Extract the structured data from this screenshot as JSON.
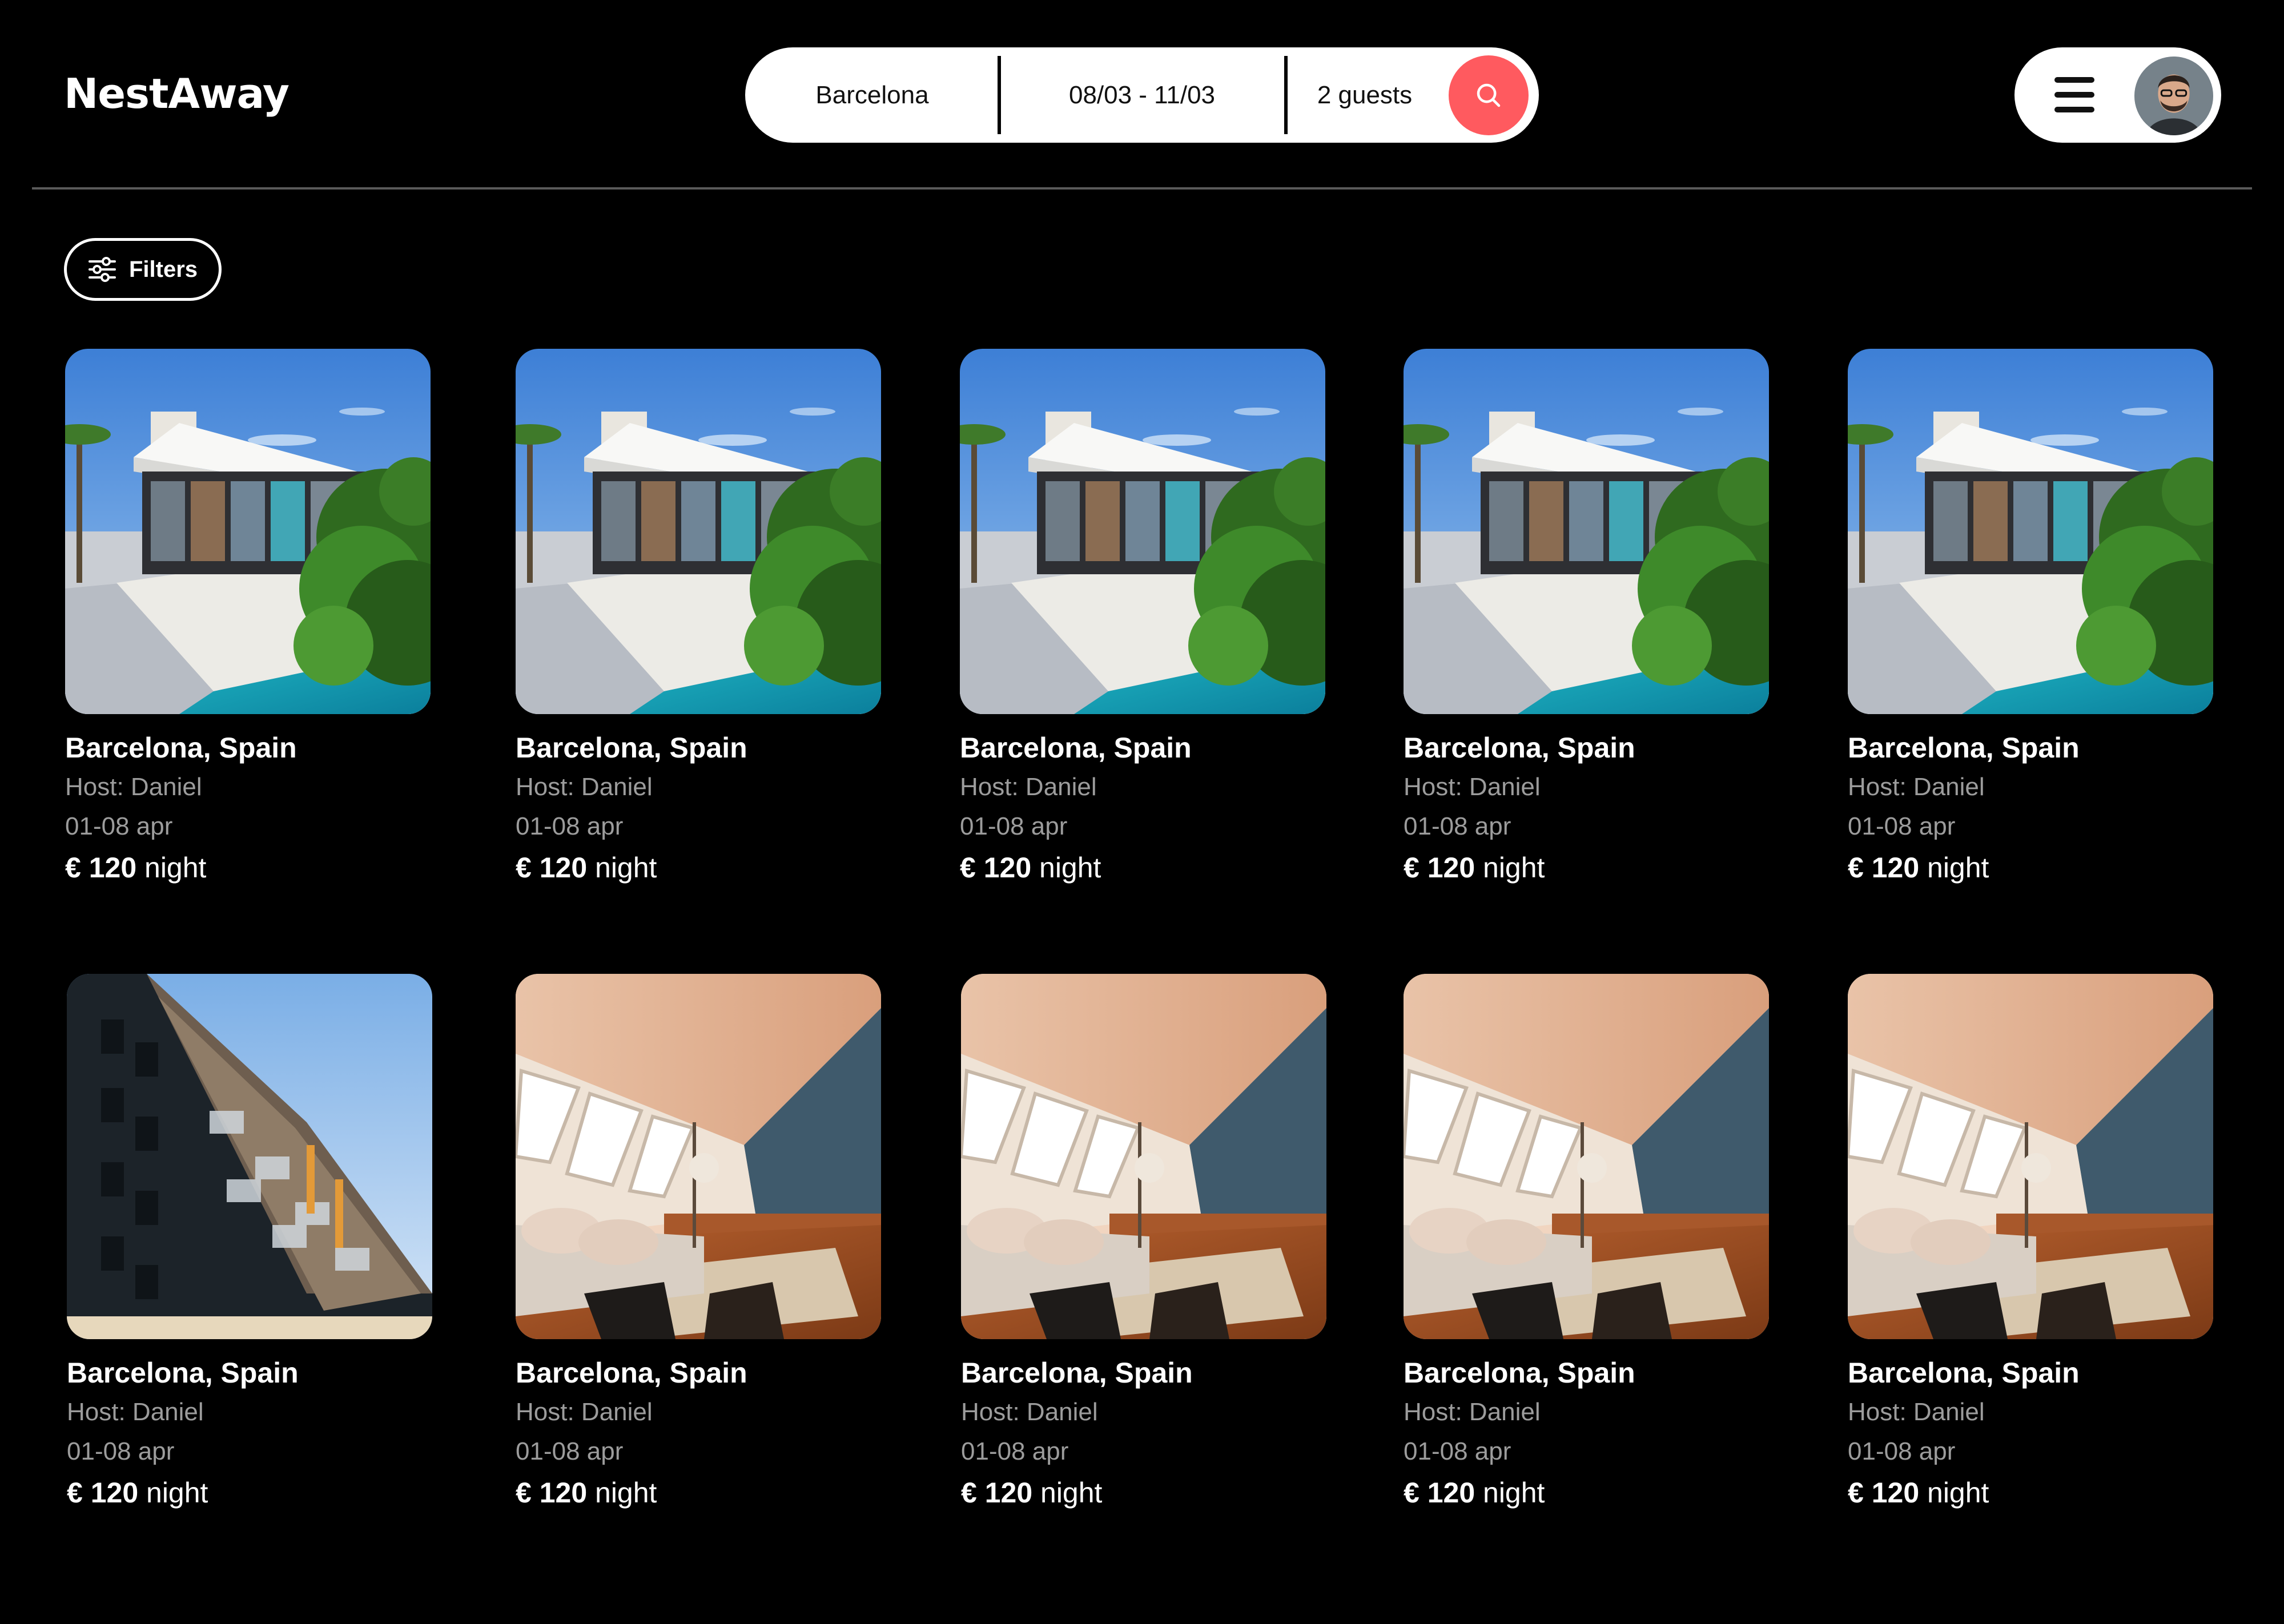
{
  "app": {
    "logo": "NestAway"
  },
  "search": {
    "location": "Barcelona",
    "dates": "08/03 - 11/03",
    "guests": "2 guests",
    "search_icon": "search-icon",
    "accent": "#ff5a5f"
  },
  "account": {
    "menu_icon": "hamburger-menu-icon",
    "avatar": "user-avatar"
  },
  "filters": {
    "label": "Filters",
    "icon": "sliders-icon"
  },
  "listings": [
    {
      "title": "Barcelona, Spain",
      "host": "Host: Daniel",
      "dates": "01-08 apr",
      "price": "€ 120",
      "unit": " night",
      "photo": "villa-pool"
    },
    {
      "title": "Barcelona, Spain",
      "host": "Host: Daniel",
      "dates": "01-08 apr",
      "price": "€ 120",
      "unit": " night",
      "photo": "villa-pool"
    },
    {
      "title": "Barcelona, Spain",
      "host": "Host: Daniel",
      "dates": "01-08 apr",
      "price": "€ 120",
      "unit": " night",
      "photo": "villa-pool"
    },
    {
      "title": "Barcelona, Spain",
      "host": "Host: Daniel",
      "dates": "01-08 apr",
      "price": "€ 120",
      "unit": " night",
      "photo": "villa-pool"
    },
    {
      "title": "Barcelona, Spain",
      "host": "Host: Daniel",
      "dates": "01-08 apr",
      "price": "€ 120",
      "unit": " night",
      "photo": "villa-pool"
    },
    {
      "title": "Barcelona, Spain",
      "host": "Host: Daniel",
      "dates": "01-08 apr",
      "price": "€ 120",
      "unit": " night",
      "photo": "apartment-building"
    },
    {
      "title": "Barcelona, Spain",
      "host": "Host: Daniel",
      "dates": "01-08 apr",
      "price": "€ 120",
      "unit": " night",
      "photo": "attic-living-room"
    },
    {
      "title": "Barcelona, Spain",
      "host": "Host: Daniel",
      "dates": "01-08 apr",
      "price": "€ 120",
      "unit": " night",
      "photo": "attic-living-room"
    },
    {
      "title": "Barcelona, Spain",
      "host": "Host: Daniel",
      "dates": "01-08 apr",
      "price": "€ 120",
      "unit": " night",
      "photo": "attic-living-room"
    },
    {
      "title": "Barcelona, Spain",
      "host": "Host: Daniel",
      "dates": "01-08 apr",
      "price": "€ 120",
      "unit": " night",
      "photo": "attic-living-room"
    }
  ]
}
